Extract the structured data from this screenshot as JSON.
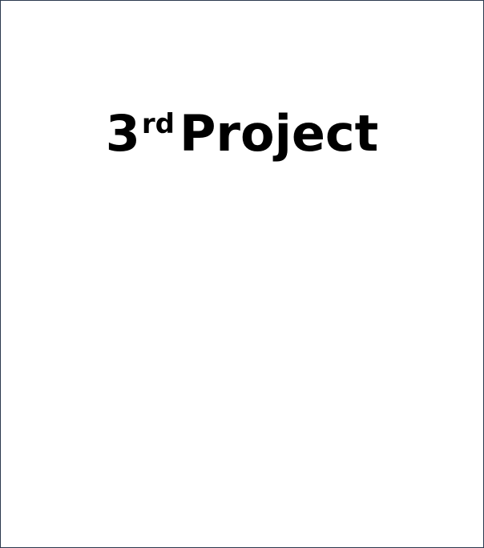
{
  "slide": {
    "title_number": "3",
    "title_suffix": "rd",
    "title_word": "Project"
  }
}
